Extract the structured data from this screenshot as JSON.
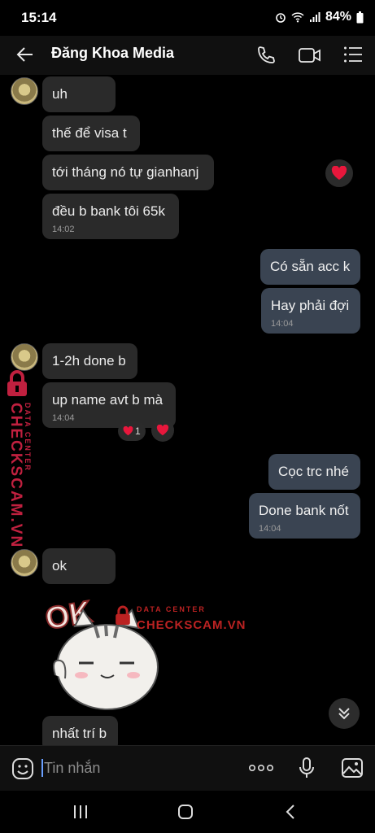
{
  "status": {
    "time": "15:14",
    "battery": "84%"
  },
  "header": {
    "title": "Đăng Khoa Media"
  },
  "messages": [
    {
      "text": "uh"
    },
    {
      "text": "thế để visa t"
    },
    {
      "text": "tới tháng nó tự gianhanj"
    },
    {
      "text": "đều b bank tôi 65k",
      "time": "14:02"
    },
    {
      "text": "Có sẵn acc k"
    },
    {
      "text": "Hay phải đợi",
      "time": "14:04"
    },
    {
      "text": "1-2h done b"
    },
    {
      "text": "up name avt b mà",
      "time": "14:04"
    },
    {
      "text": "Cọc trc nhé"
    },
    {
      "text": "Done bank nốt",
      "time": "14:04"
    },
    {
      "text": "ok"
    },
    {
      "text": "nhất trí b"
    }
  ],
  "reaction_count": "1",
  "sticker": {
    "text": "OK"
  },
  "watermark": {
    "title": "CHECKSCAM.VN",
    "subtitle": "DATA CENTER"
  },
  "input": {
    "placeholder": "Tin nhắn"
  },
  "colors": {
    "accent": "#c0203f",
    "incoming": "#2a2a2a",
    "outgoing": "#3a4452",
    "heart": "#e8173c"
  }
}
